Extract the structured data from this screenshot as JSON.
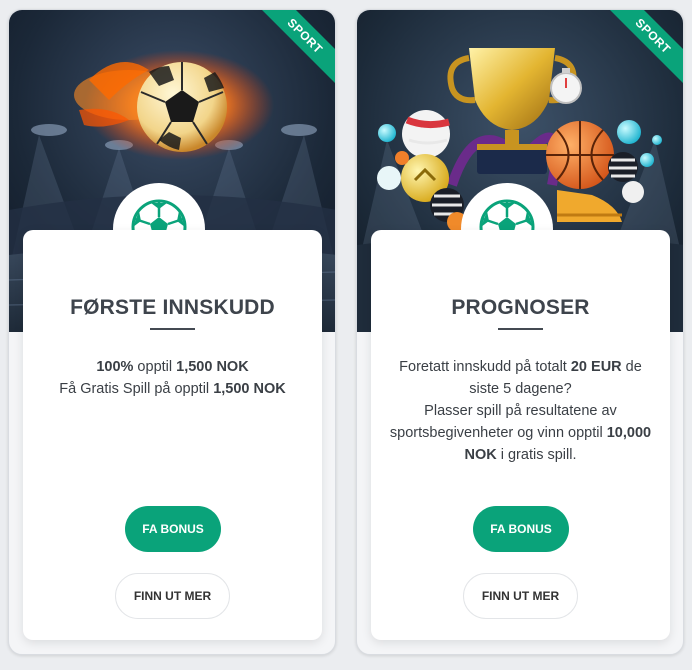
{
  "cards": [
    {
      "ribbon": "SPORT",
      "title": "FØRSTE INNSKUDD",
      "desc": [
        {
          "b": "100%"
        },
        {
          "t": " opptil "
        },
        {
          "b": "1,500 NOK"
        },
        {
          "br": true
        },
        {
          "t": "Få Gratis Spill på opptil "
        },
        {
          "b": "1,500 NOK"
        }
      ],
      "primary_button": "FA BONUS",
      "secondary_button": "FINN UT MER",
      "badge_icon": "soccer-ball-icon",
      "hero_image": "flaming-soccer-ball-stadium"
    },
    {
      "ribbon": "SPORT",
      "title": "PROGNOSER",
      "desc": [
        {
          "t": "Foretatt innskudd på totalt "
        },
        {
          "b": "20 EUR"
        },
        {
          "t": " de siste 5 dagene?"
        },
        {
          "br": true
        },
        {
          "t": "Plasser spill på resultatene av sportsbegivenheter og vinn opptil "
        },
        {
          "b": "10,000 NOK"
        },
        {
          "t": " i gratis spill."
        }
      ],
      "primary_button": "FA BONUS",
      "secondary_button": "FINN UT MER",
      "badge_icon": "soccer-ball-icon",
      "hero_image": "trophy-and-sports-balls"
    }
  ],
  "colors": {
    "accent": "#0aa37a",
    "title": "#3e444c",
    "page_bg": "#ebedf0"
  }
}
